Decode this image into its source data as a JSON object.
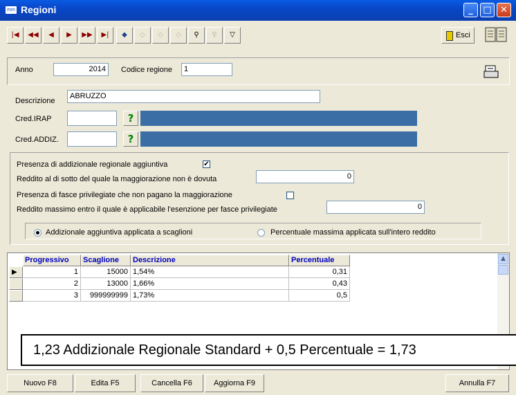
{
  "window": {
    "title": "Regioni",
    "app_icon_text": "mm"
  },
  "toolbar": {
    "nav_buttons": [
      {
        "icon": "first-record-icon",
        "glyph": "⏮"
      },
      {
        "icon": "fast-rewind-icon",
        "glyph": "◀◀"
      },
      {
        "icon": "prev-record-icon",
        "glyph": "◀"
      },
      {
        "icon": "next-record-icon",
        "glyph": "▶"
      },
      {
        "icon": "fast-forward-icon",
        "glyph": "▶▶"
      },
      {
        "icon": "last-record-icon",
        "glyph": "⏭"
      }
    ],
    "esci_label": "Esci"
  },
  "header": {
    "anno_label": "Anno",
    "anno_value": "2014",
    "codice_label": "Codice regione",
    "codice_value": "1"
  },
  "form": {
    "descrizione_label": "Descrizione",
    "descrizione_value": "ABRUZZO",
    "cred_irap_label": "Cred.IRAP",
    "cred_irap_value": "",
    "cred_addiz_label": "Cred.ADDIZ.",
    "cred_addiz_value": "",
    "question_glyph": "?"
  },
  "options": {
    "presenza_addizionale_label": "Presenza di addizionale regionale aggiuntiva",
    "presenza_addizionale_checked": true,
    "reddito_sotto_label": "Reddito al di sotto del quale la maggiorazione non è dovuta",
    "reddito_sotto_value": "0",
    "presenza_fasce_label": "Presenza di fasce privilegiate che non pagano la maggiorazione",
    "presenza_fasce_checked": false,
    "reddito_massimo_label": "Reddito massimo entro il quale è applicabile l'esenzione per fasce privilegiate",
    "reddito_massimo_value": "0",
    "radio_scaglioni_label": "Addizionale aggiuntiva applicata a scaglioni",
    "radio_percentuale_label": "Percentuale massima applicata sull'intero reddito",
    "selected_radio": "scaglioni"
  },
  "table": {
    "columns": [
      "Progressivo",
      "Scaglione",
      "Descrizione",
      "Percentuale"
    ],
    "rows": [
      {
        "progressivo": "1",
        "scaglione": "15000",
        "descrizione": "1,54%",
        "percentuale": "0,31"
      },
      {
        "progressivo": "2",
        "scaglione": "13000",
        "descrizione": "1,66%",
        "percentuale": "0,43"
      },
      {
        "progressivo": "3",
        "scaglione": "999999999",
        "descrizione": "1,73%",
        "percentuale": "0,5"
      }
    ]
  },
  "annotation": {
    "text": "1,23 Addizionale Regionale Standard  + 0,5 Percentuale = 1,73"
  },
  "bottom": {
    "nuovo": "Nuovo F8",
    "edita": "Edita F5",
    "cancella": "Cancella F6",
    "aggiorna": "Aggiorna F9",
    "annulla": "Annulla F7"
  },
  "colors": {
    "titlebar": "#0A5BE3",
    "blue_field": "#3A6EA5",
    "header_text": "#0000C0"
  }
}
